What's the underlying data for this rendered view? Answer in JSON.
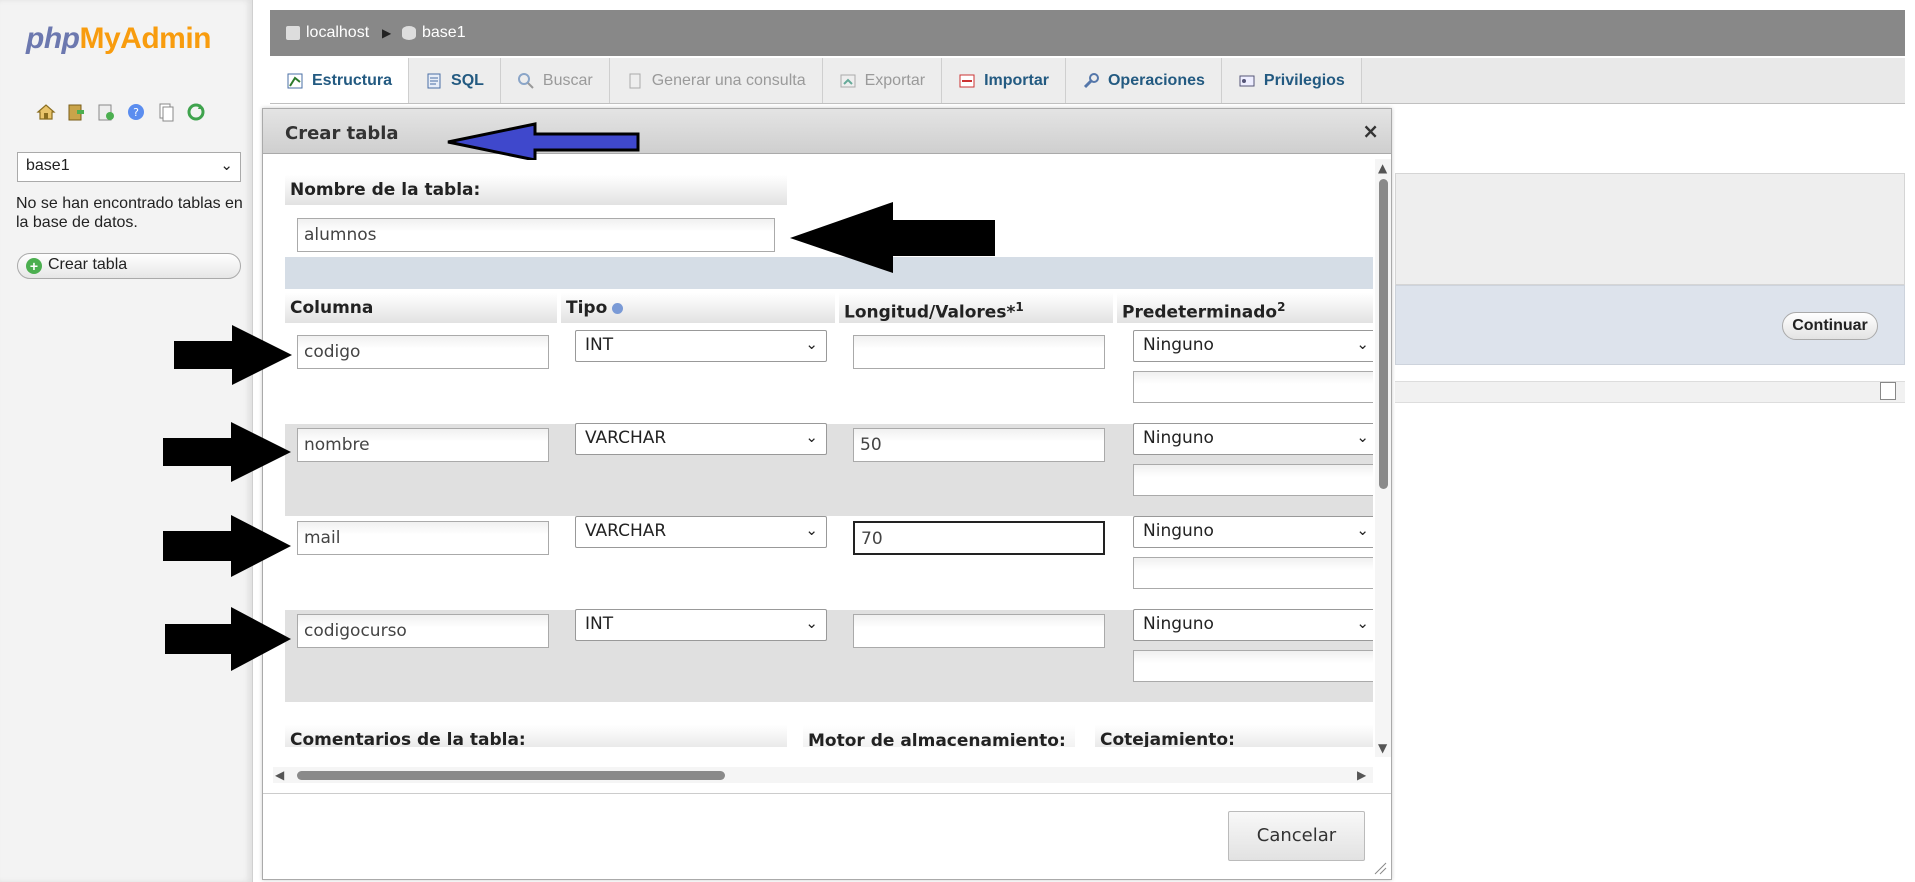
{
  "app": {
    "logo_php": "php",
    "logo_myadmin": "MyAdmin"
  },
  "nav": {
    "db_selected": "base1",
    "no_tables_text": "No se han encontrado tablas en la base de datos.",
    "create_table_label": "Crear tabla"
  },
  "breadcrumb": {
    "server": "localhost",
    "database": "base1"
  },
  "tabs": [
    {
      "label": "Estructura",
      "icon": "structure-icon",
      "enabled": true
    },
    {
      "label": "SQL",
      "icon": "sql-icon",
      "enabled": true
    },
    {
      "label": "Buscar",
      "icon": "search-icon",
      "enabled": false
    },
    {
      "label": "Generar una consulta",
      "icon": "query-icon",
      "enabled": false
    },
    {
      "label": "Exportar",
      "icon": "export-icon",
      "enabled": false
    },
    {
      "label": "Importar",
      "icon": "import-icon",
      "enabled": true
    },
    {
      "label": "Operaciones",
      "icon": "wrench-icon",
      "enabled": true
    },
    {
      "label": "Privilegios",
      "icon": "privileges-icon",
      "enabled": true
    }
  ],
  "background": {
    "continue_label": "Continuar"
  },
  "dialog": {
    "title": "Crear tabla",
    "close_symbol": "×",
    "table_name_label": "Nombre de la tabla:",
    "table_name_value": "alumnos",
    "columns_header": {
      "column": "Columna",
      "type": "Tipo",
      "length": "Longitud/Valores*",
      "length_sup": "1",
      "default": "Predeterminado",
      "default_sup": "2"
    },
    "rows": [
      {
        "name": "codigo",
        "type": "INT",
        "length": "",
        "default": "Ninguno"
      },
      {
        "name": "nombre",
        "type": "VARCHAR",
        "length": "50",
        "default": "Ninguno"
      },
      {
        "name": "mail",
        "type": "VARCHAR",
        "length": "70",
        "default": "Ninguno"
      },
      {
        "name": "codigocurso",
        "type": "INT",
        "length": "",
        "default": "Ninguno"
      }
    ],
    "footer_labels": {
      "comments": "Comentarios de la tabla:",
      "engine": "Motor de almacenamiento:",
      "collation": "Cotejamiento:"
    },
    "cancel_label": "Cancelar"
  },
  "colors": {
    "topbar": "#888888",
    "tab_text": "#235a81",
    "annotation_blue": "#3f48cc",
    "annotation_black": "#000000"
  }
}
